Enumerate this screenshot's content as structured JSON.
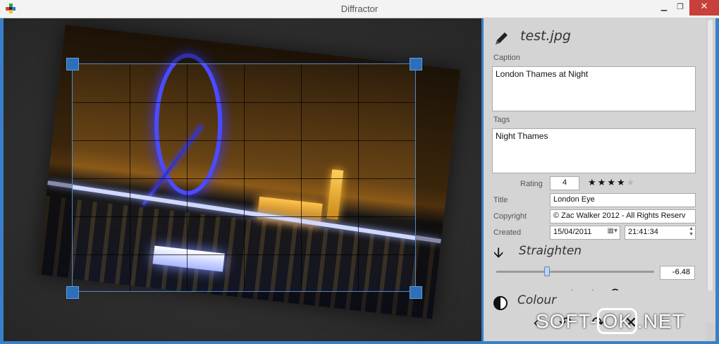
{
  "window": {
    "title": "Diffractor",
    "minimize": "▁",
    "maximize": "❐",
    "close": "✕"
  },
  "photo": {
    "rotation_degrees": -6.48
  },
  "panel": {
    "file_name": "test.jpg",
    "caption": {
      "label": "Caption",
      "value": "London Thames at Night"
    },
    "tags": {
      "label": "Tags",
      "value": "Night Thames"
    },
    "rating": {
      "label": "Rating",
      "value": "4",
      "stars_filled": 4,
      "stars_total": 5
    },
    "title": {
      "label": "Title",
      "value": "London Eye"
    },
    "copyright": {
      "label": "Copyright",
      "value": "© Zac Walker 2012 - All Rights Reserv"
    },
    "created": {
      "label": "Created",
      "date": "15/04/2011",
      "time": "21:41:34"
    },
    "straighten": {
      "label": "Straighten",
      "value": "-6.48",
      "slider_fraction": 0.32
    },
    "color": {
      "label": "Colour"
    }
  },
  "watermark": {
    "left": "SOFT-",
    "box": "OK",
    "right": ".NET"
  },
  "colors": {
    "accent": "#3a7fc9",
    "close": "#c7403a",
    "panel": "#d4d4d4",
    "crop_handle": "#2d6fb8"
  }
}
